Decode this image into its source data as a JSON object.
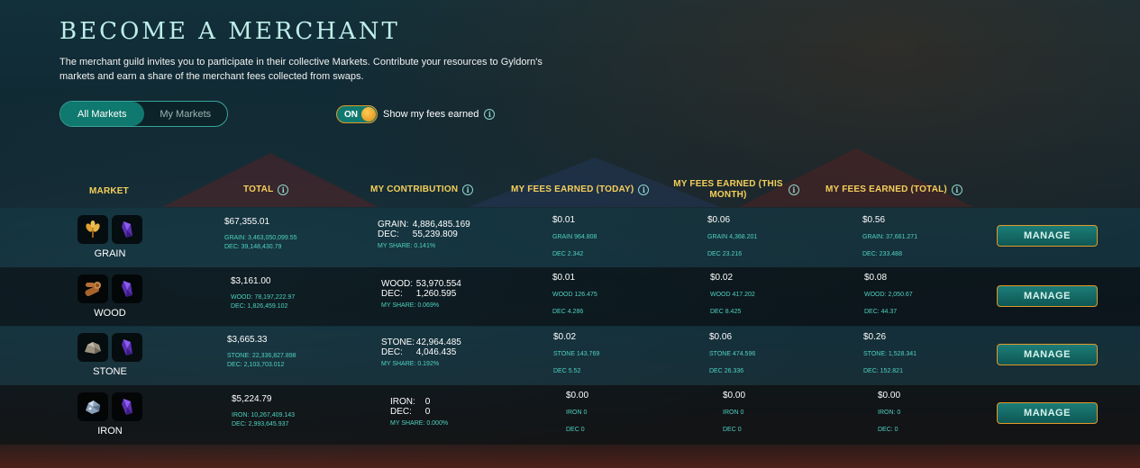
{
  "title": "BECOME A MERCHANT",
  "intro": "The merchant guild invites you to participate in their collective Markets. Contribute your resources to Gyldorn's markets and earn a share of the merchant fees collected from swaps.",
  "tabs": [
    {
      "label": "All Markets",
      "active": true
    },
    {
      "label": "My Markets",
      "active": false
    }
  ],
  "toggle": {
    "state": "ON",
    "label": "Show my fees earned"
  },
  "columns": {
    "market": "MARKET",
    "total": "TOTAL",
    "contribution": "MY CONTRIBUTION",
    "fees_today": "MY FEES EARNED (TODAY)",
    "fees_month": "MY FEES EARNED (THIS MONTH)",
    "fees_total": "MY FEES EARNED (TOTAL)"
  },
  "rows": [
    {
      "name": "GRAIN",
      "icon": "grain-icon",
      "total": "$67,355.01",
      "total_res": "GRAIN: 3,463,050,099.55",
      "total_dec": "DEC: 39,148,430.79",
      "c_res_label": "GRAIN:",
      "c_res_val": "4,886,485.169",
      "c_dec_label": "DEC:",
      "c_dec_val": "55,239.809",
      "share": "MY SHARE: 0.141%",
      "today": "$0.01",
      "today_res": "GRAIN 964.808",
      "today_dec": "DEC 2.342",
      "month": "$0.06",
      "month_res": "GRAIN 4,368.201",
      "month_dec": "DEC 23.216",
      "total_fees": "$0.56",
      "tf_res": "GRAIN: 37,661.271",
      "tf_dec": "DEC: 233.488",
      "manage": "MANAGE"
    },
    {
      "name": "WOOD",
      "icon": "wood-icon",
      "total": "$3,161.00",
      "total_res": "WOOD: 78,197,222.97",
      "total_dec": "DEC: 1,826,459.102",
      "c_res_label": "WOOD:",
      "c_res_val": "53,970.554",
      "c_dec_label": "DEC:",
      "c_dec_val": "1,260.595",
      "share": "MY SHARE: 0.069%",
      "today": "$0.01",
      "today_res": "WOOD 126.475",
      "today_dec": "DEC 4.286",
      "month": "$0.02",
      "month_res": "WOOD 417.202",
      "month_dec": "DEC 8.425",
      "total_fees": "$0.08",
      "tf_res": "WOOD: 2,050.67",
      "tf_dec": "DEC: 44.37",
      "manage": "MANAGE"
    },
    {
      "name": "STONE",
      "icon": "stone-icon",
      "total": "$3,665.33",
      "total_res": "STONE: 22,336,827.898",
      "total_dec": "DEC: 2,103,703.012",
      "c_res_label": "STONE:",
      "c_res_val": "42,964.485",
      "c_dec_label": "DEC:",
      "c_dec_val": "4,046.435",
      "share": "MY SHARE: 0.192%",
      "today": "$0.02",
      "today_res": "STONE 143.769",
      "today_dec": "DEC 5.52",
      "month": "$0.06",
      "month_res": "STONE 474.596",
      "month_dec": "DEC 26.336",
      "total_fees": "$0.26",
      "tf_res": "STONE: 1,528.341",
      "tf_dec": "DEC: 152.821",
      "manage": "MANAGE"
    },
    {
      "name": "IRON",
      "icon": "iron-icon",
      "total": "$5,224.79",
      "total_res": "IRON: 10,267,409.143",
      "total_dec": "DEC: 2,993,645.937",
      "c_res_label": "IRON:",
      "c_res_val": "0",
      "c_dec_label": "DEC:",
      "c_dec_val": "0",
      "share": "MY SHARE: 0.000%",
      "today": "$0.00",
      "today_res": "IRON 0",
      "today_dec": "DEC 0",
      "month": "$0.00",
      "month_res": "IRON 0",
      "month_dec": "DEC 0",
      "total_fees": "$0.00",
      "tf_res": "IRON: 0",
      "tf_dec": "DEC: 0",
      "manage": "MANAGE"
    }
  ],
  "colors": {
    "accent": "#10796f",
    "header_gold": "#f5cf5a",
    "sub_teal": "#4fd2c2",
    "button_border": "#e09a2a"
  }
}
